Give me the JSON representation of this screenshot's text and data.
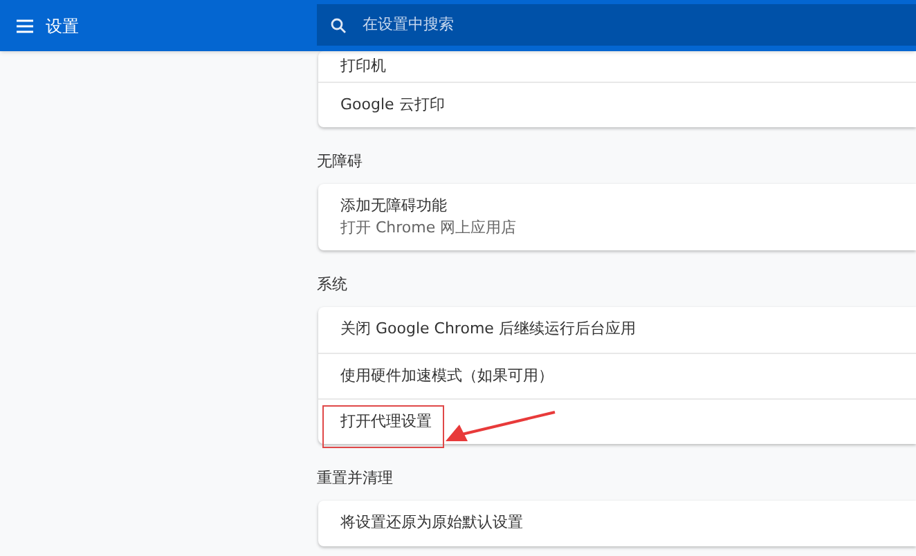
{
  "header": {
    "title": "设置",
    "search": {
      "placeholder": "在设置中搜索"
    }
  },
  "sections": [
    {
      "rows": [
        {
          "title": "打印机"
        },
        {
          "title": "Google 云打印"
        }
      ]
    },
    {
      "heading": "无障碍",
      "rows": [
        {
          "title": "添加无障碍功能",
          "subtitle": "打开 Chrome 网上应用店"
        }
      ]
    },
    {
      "heading": "系统",
      "rows": [
        {
          "title": "关闭 Google Chrome 后继续运行后台应用",
          "highlighted": false
        },
        {
          "title": "使用硬件加速模式（如果可用）",
          "highlighted": false
        },
        {
          "title": "打开代理设置",
          "highlighted": true
        }
      ]
    },
    {
      "heading": "重置并清理",
      "rows": [
        {
          "title": "将设置还原为原始默认设置"
        }
      ]
    }
  ]
}
